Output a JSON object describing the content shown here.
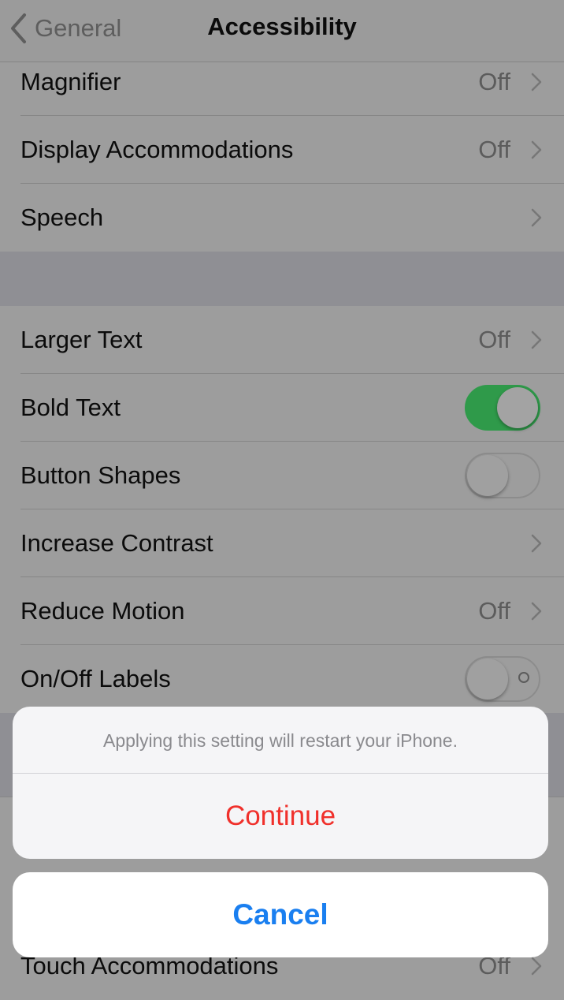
{
  "nav": {
    "back_label": "General",
    "title": "Accessibility"
  },
  "section1": [
    {
      "label": "Magnifier",
      "value": "Off",
      "accessory": "chevron"
    },
    {
      "label": "Display Accommodations",
      "value": "Off",
      "accessory": "chevron"
    },
    {
      "label": "Speech",
      "value": "",
      "accessory": "chevron"
    }
  ],
  "section2": [
    {
      "label": "Larger Text",
      "value": "Off",
      "accessory": "chevron"
    },
    {
      "label": "Bold Text",
      "toggle": true
    },
    {
      "label": "Button Shapes",
      "toggle": false
    },
    {
      "label": "Increase Contrast",
      "value": "",
      "accessory": "chevron"
    },
    {
      "label": "Reduce Motion",
      "value": "Off",
      "accessory": "chevron"
    },
    {
      "label": "On/Off Labels",
      "toggle": false
    }
  ],
  "section3": [
    {
      "label": "Touch Accommodations",
      "value": "Off",
      "accessory": "chevron"
    }
  ],
  "action_sheet": {
    "message": "Applying this setting will restart your iPhone.",
    "continue_label": "Continue",
    "cancel_label": "Cancel"
  },
  "colors": {
    "destructive": "#f0302b",
    "cancel": "#1a7ff0",
    "toggle_on": "#2f9a4a"
  }
}
